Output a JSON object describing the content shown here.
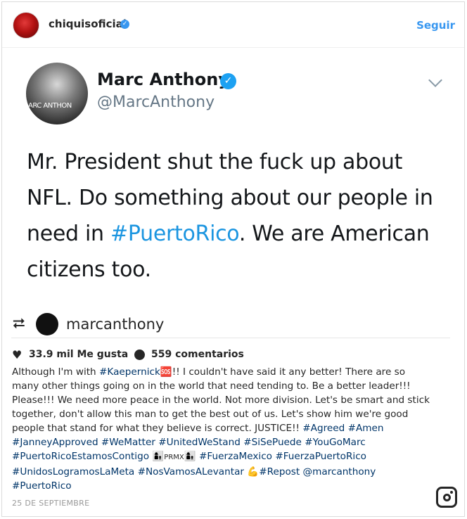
{
  "header": {
    "username": "chiquisoficial",
    "follow_label": "Seguir"
  },
  "tweet": {
    "name": "Marc Anthony",
    "handle": "@MarcAnthony",
    "avatar_text": "ARC ANTHON",
    "text_before": "Mr. President shut the fuck up about NFL. Do something about our people in need in ",
    "hashtag": "#PuertoRico",
    "text_after": ". We are American citizens too."
  },
  "repost": {
    "icon": "repost-icon",
    "username": "marcanthony"
  },
  "stats": {
    "likes": "33.9 mil Me gusta",
    "comments": "559 comentarios"
  },
  "caption": {
    "part1": "Although I'm with ",
    "tag_kaepernick": "#Kaepernick",
    "emoji_1": "🆘",
    "part2": "!! I couldn't have said it any better! There are so many other things going on in the world that need tending to. Be a better leader!!! Please!!! We need more peace in the world. Not more division. Let's be smart and stick together, don't allow this man to get the best out of us. Let's show him we're good people that stand for what they believe is correct. JUSTICE!! ",
    "tags_1": "#Agreed #Amen #JanneyApproved #WeMatter #UnitedWeStand #SiSePuede #YouGoMarc #PuertoRicoEstamosContigo",
    "emoji_2": "👩‍👦",
    "prmx": "PRMX",
    "emoji_3": "👩‍👦",
    "tags_2": "#FuerzaMexico #FuerzaPuertoRico #UnidosLogramosLaMeta #NosVamosALevantar",
    "emoji_4": "💪",
    "tags_3": "#Repost @marcanthony #PuertoRico"
  },
  "date": "25 DE SEPTIEMBRE",
  "colors": {
    "link": "#003569",
    "follow": "#3897f0",
    "twitter_link": "#1b95e0"
  }
}
